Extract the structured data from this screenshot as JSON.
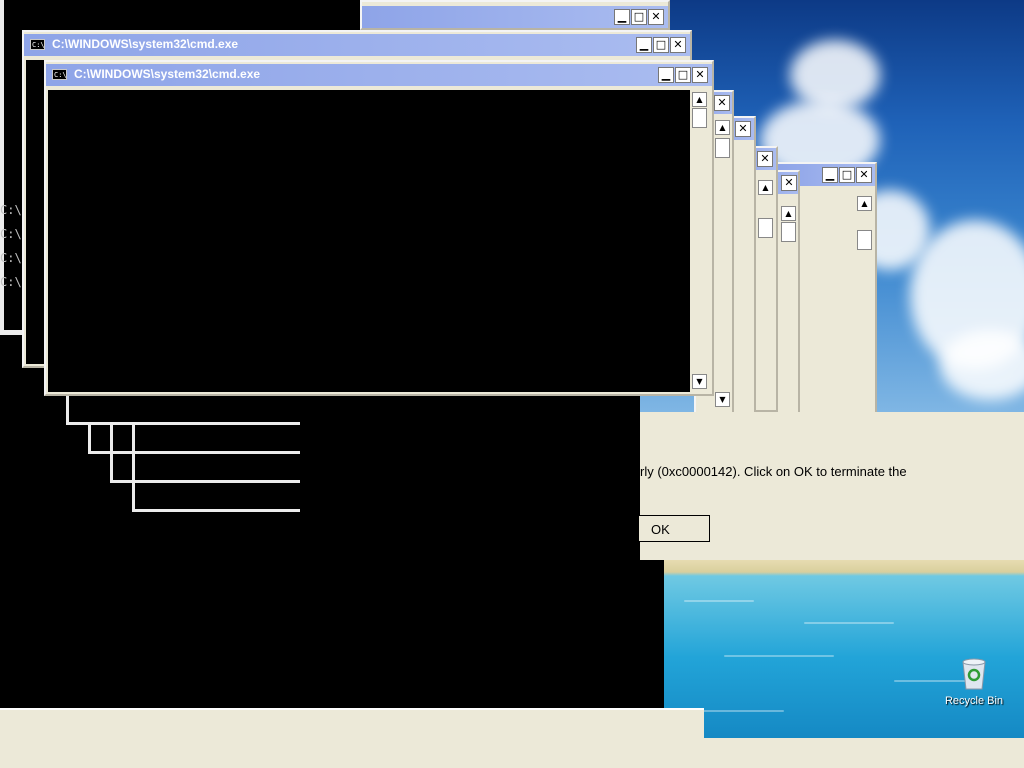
{
  "window_title": "C:\\WINDOWS\\system32\\cmd.exe",
  "cmd_icon_text": "C:\\",
  "controls": {
    "minimize": "▁",
    "maximize": "□",
    "close": "✕"
  },
  "scroll": {
    "up": "▲",
    "down": "▼"
  },
  "prompt_lines": [
    "C:\\",
    "C:\\",
    "C:\\",
    "C:\\"
  ],
  "error_dialog": {
    "message": "rly (0xc0000142). Click on OK to terminate the",
    "ok_label": "OK"
  },
  "desktop": {
    "recycle_bin_label": "Recycle Bin"
  }
}
